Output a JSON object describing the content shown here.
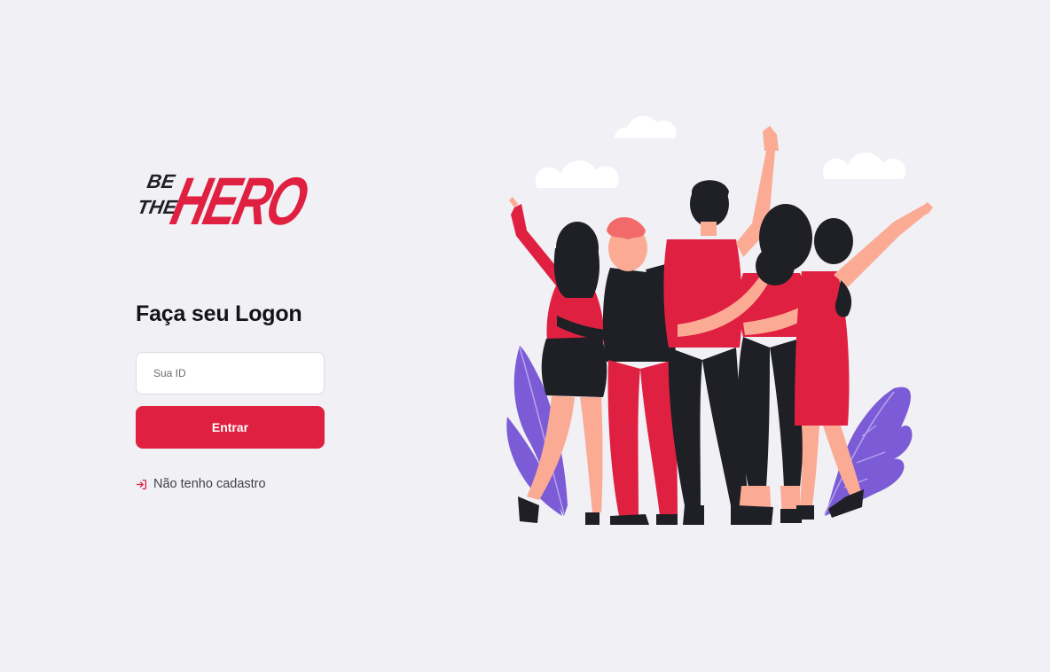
{
  "brand": {
    "logo_top": "BE",
    "logo_middle": "THE",
    "logo_word": "HERO"
  },
  "login": {
    "title": "Faça seu Logon",
    "id_placeholder": "Sua ID",
    "id_value": "",
    "submit_label": "Entrar",
    "register_link_label": "Não tenho cadastro"
  },
  "icons": {
    "register_link": "log-in-icon"
  },
  "colors": {
    "background": "#f0f0f5",
    "accent": "#e02041",
    "text_dark": "#13131a",
    "text_muted": "#41414d",
    "logo_dark": "#1f1f26",
    "illustration_purple": "#7b5cd6",
    "illustration_skin": "#fbaa94"
  }
}
